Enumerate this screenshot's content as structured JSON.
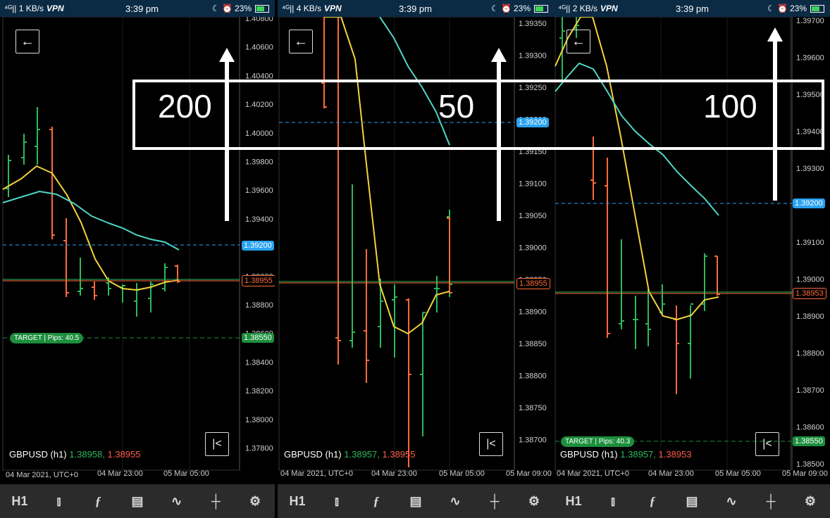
{
  "panels": [
    {
      "id": "p1",
      "status": {
        "net": "1 KB/s",
        "vpn": "VPN",
        "time": "3:39 pm",
        "battery": "23%"
      },
      "symbol": "GBPUSD (h1)",
      "bid": "1.38958,",
      "ask": "1.38955",
      "y_axis_labels": [
        "1.40800",
        "1.40600",
        "1.40400",
        "1.40200",
        "1.40000",
        "1.39800",
        "1.39600",
        "1.39400",
        "1.39200",
        "1.39000",
        "1.38800",
        "1.38600",
        "1.38550",
        "1.38400",
        "1.38200",
        "1.38000",
        "1.37800"
      ],
      "tags": {
        "blue": "1.39200",
        "orange": "1.38955",
        "green": "1.38550"
      },
      "target": "TARGET  | Pips: 40.5",
      "x_axis_labels": [
        "04 Mar 2021, UTC+0",
        "04 Mar 23:00",
        "05 Mar 05:00"
      ],
      "overlay_number": "200"
    },
    {
      "id": "p2",
      "status": {
        "net": "4 KB/s",
        "vpn": "VPN",
        "time": "3:39 pm",
        "battery": "23%"
      },
      "symbol": "GBPUSD (h1)",
      "bid": "1.38957,",
      "ask": "1.38955",
      "y_axis_labels": [
        "1.39350",
        "1.39300",
        "1.39250",
        "1.39200",
        "1.39150",
        "1.39100",
        "1.39050",
        "1.39000",
        "1.38950",
        "1.38900",
        "1.38850",
        "1.38800",
        "1.38750",
        "1.38700"
      ],
      "tags": {
        "blue": "1.39200",
        "orange": "1.38955"
      },
      "x_axis_labels": [
        "04 Mar 2021, UTC+0",
        "04 Mar 23:00",
        "05 Mar 05:00",
        "05 Mar 09:00"
      ],
      "overlay_number": "50"
    },
    {
      "id": "p3",
      "status": {
        "net": "2 KB/s",
        "vpn": "VPN",
        "time": "3:39 pm",
        "battery": "23%"
      },
      "symbol": "GBPUSD (h1)",
      "bid": "1.38957,",
      "ask": "1.38953",
      "y_axis_labels": [
        "1.39700",
        "1.39600",
        "1.39500",
        "1.39400",
        "1.39300",
        "1.39200",
        "1.39100",
        "1.39000",
        "1.38900",
        "1.38800",
        "1.38700",
        "1.38600",
        "1.38550",
        "1.38500"
      ],
      "tags": {
        "blue": "1.39200",
        "orange": "1.38953",
        "green": "1.38550"
      },
      "target": "TARGET  | Pips: 40.3",
      "x_axis_labels": [
        "04 Mar 2021, UTC+0",
        "04 Mar 23:00",
        "05 Mar 05:00",
        "05 Mar 09:00"
      ],
      "overlay_number": "100"
    }
  ],
  "toolbar": {
    "timeframe": "H1",
    "icons": [
      "candlestick-icon",
      "function-icon",
      "add-indicator-icon",
      "draw-icon",
      "crosshair-icon",
      "settings-icon"
    ]
  },
  "colors": {
    "bull": "#2db85a",
    "bear": "#ff6a3a",
    "ma_fast": "#f2d23c",
    "ma_slow": "#4fd6c6",
    "blue_tag": "#2aa2f0",
    "target": "#1c8f3d"
  }
}
